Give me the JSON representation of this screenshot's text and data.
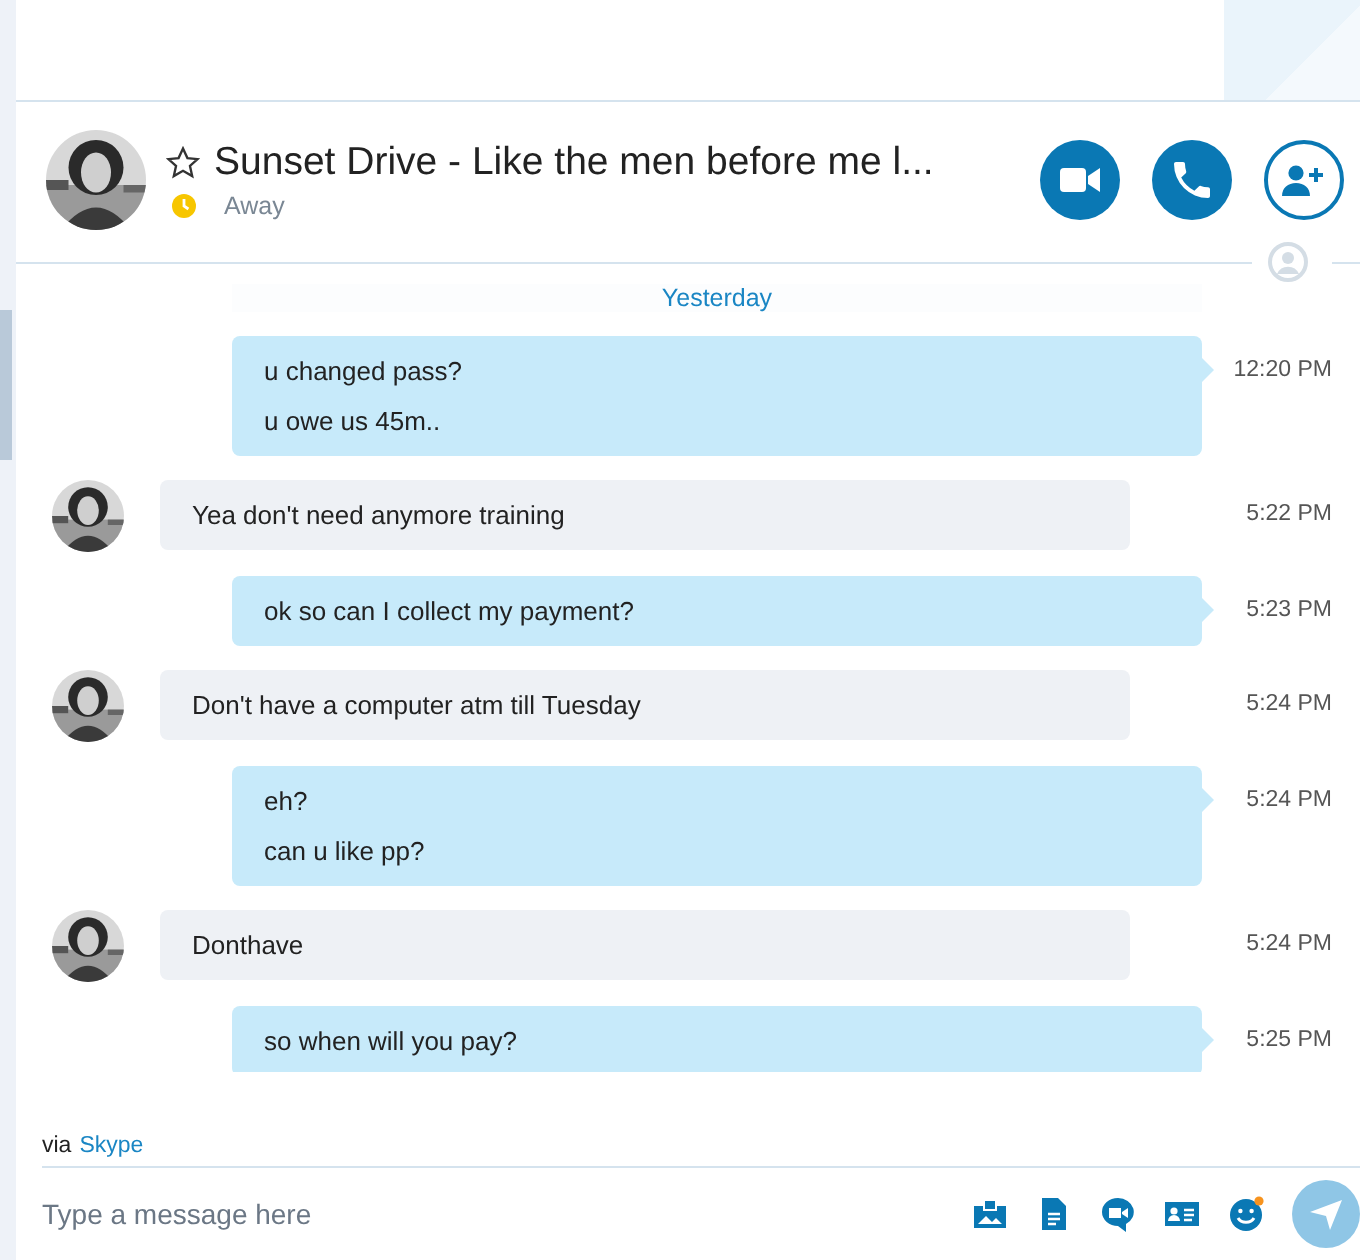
{
  "contact": {
    "name": "Sunset Drive - Like the men before me l...",
    "favorite": false,
    "status": "Away"
  },
  "date_separator": "Yesterday",
  "messages": [
    {
      "kind": "out",
      "lines": [
        "u changed pass?",
        "u owe us 45m.."
      ],
      "time": "12:20 PM"
    },
    {
      "kind": "in",
      "lines": [
        "Yea don't need anymore training"
      ],
      "time": "5:22 PM"
    },
    {
      "kind": "out",
      "lines": [
        "ok so can I collect my payment?"
      ],
      "time": "5:23 PM"
    },
    {
      "kind": "in",
      "lines": [
        "Don't have a computer atm till Tuesday"
      ],
      "time": "5:24 PM"
    },
    {
      "kind": "out",
      "lines": [
        "eh?",
        "can u like pp?"
      ],
      "time": "5:24 PM"
    },
    {
      "kind": "in",
      "lines": [
        "Donthave"
      ],
      "time": "5:24 PM"
    },
    {
      "kind": "out",
      "lines": [
        "so when will you pay?"
      ],
      "time": "5:25 PM"
    }
  ],
  "via": {
    "prefix": "via",
    "link": "Skype"
  },
  "composer": {
    "placeholder": "Type a message here"
  }
}
